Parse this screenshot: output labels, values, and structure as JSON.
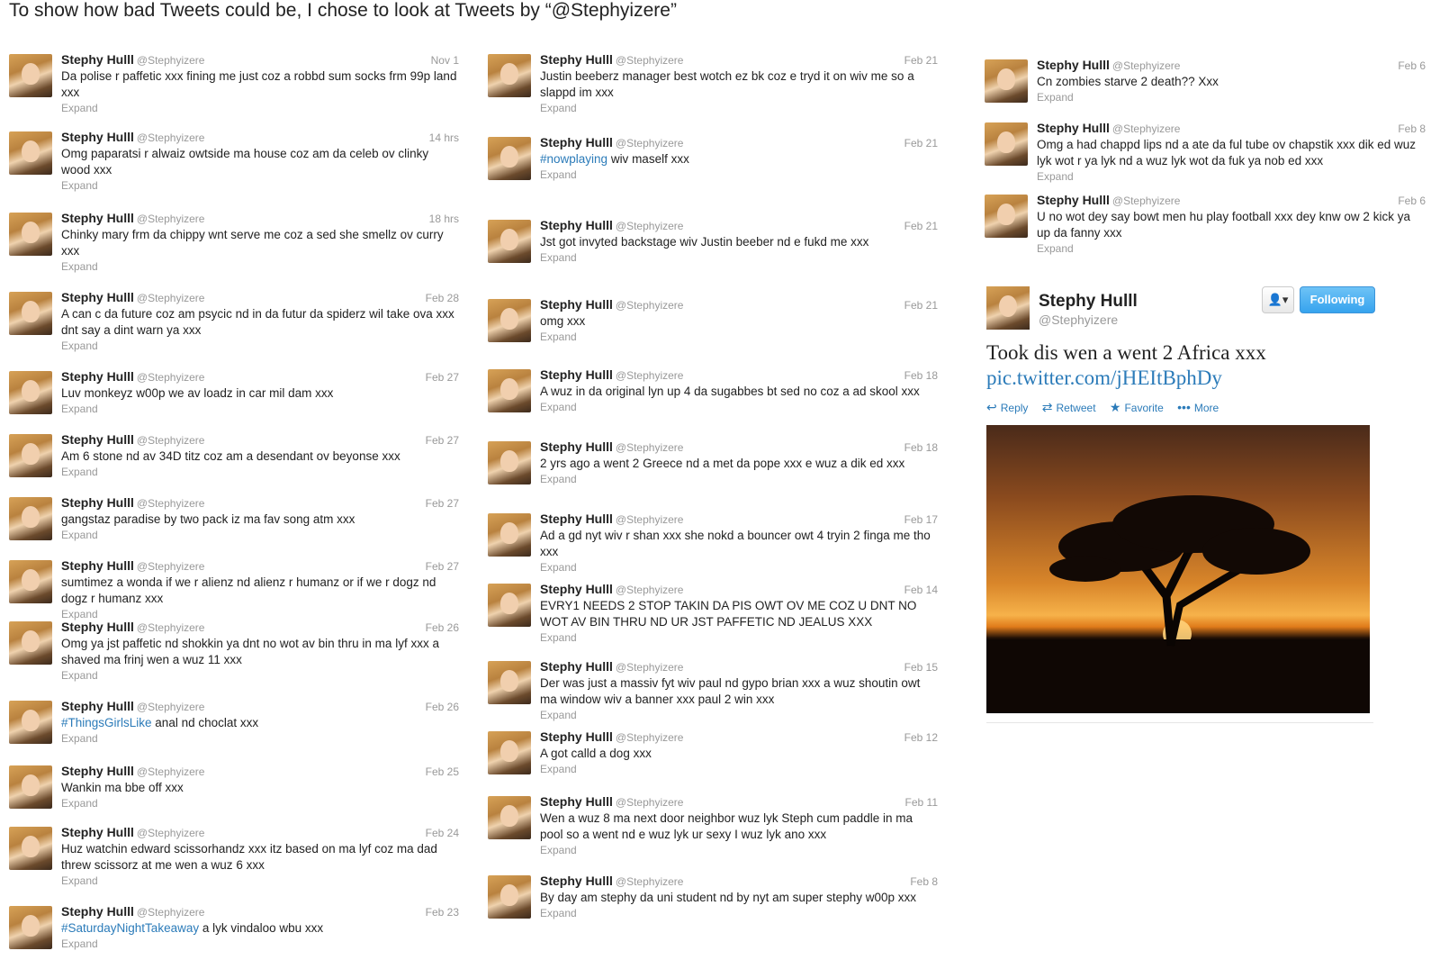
{
  "heading": "To show how bad Tweets could be, I chose to look at Tweets by “@Stephyizere”",
  "author": {
    "name": "Stephy Hulll",
    "handle": "@Stephyizere"
  },
  "expand_label": "Expand",
  "col1": [
    {
      "date": "Nov 1",
      "text": "Da polise r paffetic xxx fining me just coz a robbd sum socks frm 99p land xxx"
    },
    {
      "date": "14 hrs",
      "text": "Omg paparatsi r alwaiz owtside ma house coz am da celeb ov clinky wood xxx"
    },
    {
      "date": "18 hrs",
      "text": "Chinky mary frm da chippy wnt serve me coz a sed she smellz ov curry xxx"
    },
    {
      "date": "Feb 28",
      "text": "A can c da future coz am psycic nd in da futur da spiderz wil take ova xxx dnt say a dint warn ya xxx"
    },
    {
      "date": "Feb 27",
      "text": "Luv monkeyz w00p we av loadz in car mil dam xxx"
    },
    {
      "date": "Feb 27",
      "text": "Am 6 stone nd av 34D titz coz am a desendant ov beyonse xxx"
    },
    {
      "date": "Feb 27",
      "text": "gangstaz paradise by two pack iz ma fav song atm xxx"
    },
    {
      "date": "Feb 27",
      "text": "sumtimez a wonda if we r alienz nd alienz r humanz or if we r dogz nd dogz r humanz xxx"
    },
    {
      "date": "Feb 26",
      "text": "Omg ya jst paffetic nd shokkin ya dnt no wot av bin thru in ma lyf xxx a shaved ma frinj wen a wuz 11 xxx"
    },
    {
      "date": "Feb 26",
      "hashtag": "#ThingsGirlsLike",
      "text": " anal nd choclat xxx"
    },
    {
      "date": "Feb 25",
      "text": "Wankin ma bbe off xxx"
    },
    {
      "date": "Feb 24",
      "text": "Huz watchin edward scissorhandz xxx itz based on ma lyf coz ma dad threw scissorz at me wen a wuz 6 xxx"
    },
    {
      "date": "Feb 23",
      "hashtag": "#SaturdayNightTakeaway",
      "text": " a lyk vindaloo wbu xxx"
    }
  ],
  "col2": [
    {
      "date": "Feb 21",
      "text": "Justin beeberz manager best wotch ez bk coz e tryd it on wiv me so a slappd im xxx"
    },
    {
      "date": "Feb 21",
      "hashtag": "#nowplaying",
      "text": " wiv maself xxx"
    },
    {
      "date": "Feb 21",
      "text": "Jst got invyted backstage wiv Justin beeber nd e fukd me xxx"
    },
    {
      "date": "Feb 21",
      "text": "omg xxx"
    },
    {
      "date": "Feb 18",
      "text": "A wuz in da original lyn up 4 da sugabbes bt sed no coz a ad skool xxx"
    },
    {
      "date": "Feb 18",
      "text": "2 yrs ago a went 2 Greece nd a met da pope xxx e wuz a dik ed xxx"
    },
    {
      "date": "Feb 17",
      "text": "Ad a gd nyt wiv r shan xxx she nokd a bouncer owt 4 tryin 2 finga me tho xxx"
    },
    {
      "date": "Feb 14",
      "text": "EVRY1 NEEDS 2 STOP TAKIN DA PIS OWT OV ME COZ U DNT NO WOT AV BIN THRU ND UR JST PAFFETIC ND JEALUS XXX"
    },
    {
      "date": "Feb 15",
      "text": "Der was just a massiv fyt wiv paul nd gypo brian xxx a wuz shoutin owt ma window wiv a banner xxx paul 2 win xxx"
    },
    {
      "date": "Feb 12",
      "text": "A got calld a dog xxx"
    },
    {
      "date": "Feb 11",
      "text": "Wen a wuz 8 ma next door neighbor wuz lyk Steph cum paddle in ma pool so a went nd e wuz lyk ur sexy I wuz lyk ano xxx"
    },
    {
      "date": "Feb 8",
      "text": "By day am stephy da uni student nd by nyt am super stephy w00p xxx"
    }
  ],
  "col3": [
    {
      "date": "Feb 6",
      "text": "Cn zombies starve 2 death?? Xxx"
    },
    {
      "date": "Feb 8",
      "text": "Omg a had chappd lips nd a ate da ful tube ov chapstik xxx dik ed wuz lyk wot r ya lyk nd a wuz lyk wot da fuk ya nob ed xxx"
    },
    {
      "date": "Feb 6",
      "text": "U no wot dey say bowt men hu play football xxx dey knw ow 2 kick ya up da fanny xxx"
    }
  ],
  "card": {
    "name": "Stephy Hulll",
    "handle": "@Stephyizere",
    "follow_label": "Following",
    "user_menu_icon": "person-dropdown-icon",
    "text": "Took dis wen a went 2 Africa xxx",
    "link": "pic.twitter.com/jHEItBphDy",
    "actions": {
      "reply": "Reply",
      "retweet": "Retweet",
      "favorite": "Favorite",
      "more": "More"
    },
    "photo_description_icon": "sunset-tree-photo"
  },
  "colors": {
    "link": "#2b7bb9",
    "follow_button": "#36a3ee",
    "muted": "#999999"
  }
}
